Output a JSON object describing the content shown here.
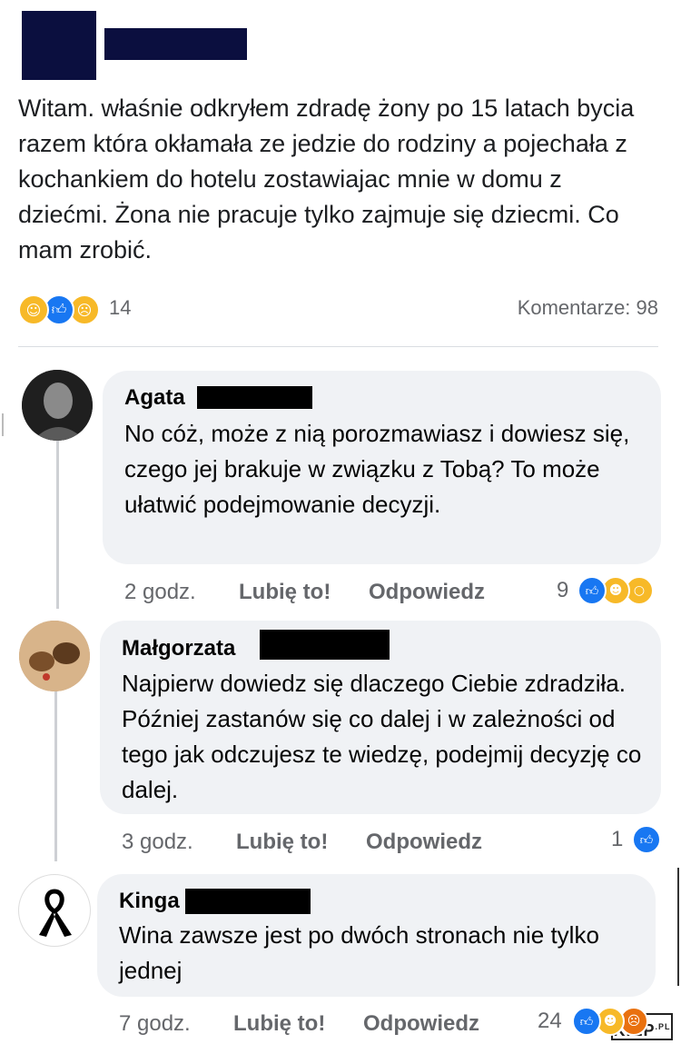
{
  "post": {
    "text": "Witam. właśnie odkryłem zdradę żony po 15 latach bycia razem która okłamała  ze jedzie do rodziny a pojechała z kochankiem do hotelu zostawiajac mnie w domu z dziećmi. Żona nie pracuje tylko zajmuje się dziecmi. Co mam zrobić.",
    "reaction_count": "14",
    "comments_label": "Komentarze: 98",
    "reaction_icons": [
      "care-icon",
      "like-icon",
      "sad-icon"
    ]
  },
  "comments": [
    {
      "name": "Agata",
      "text": "No cóż, może z nią porozmawiasz i dowiesz się, czego jej brakuje w związku z Tobą? To może ułatwić podejmowanie decyzji.",
      "time": "2 godz.",
      "like_label": "Lubię to!",
      "reply_label": "Odpowiedz",
      "reaction_count": "9",
      "reaction_icons": [
        "like-icon",
        "haha-icon",
        "wow-icon"
      ]
    },
    {
      "name": "Małgorzata",
      "text": "Najpierw dowiedz się dlaczego Ciebie zdradziła. Później zastanów się co dalej i w zależności od tego jak odczujesz te wiedzę, podejmij decyzję co dalej.",
      "time": "3 godz.",
      "like_label": "Lubię to!",
      "reply_label": "Odpowiedz",
      "reaction_count": "1",
      "reaction_icons": [
        "like-icon"
      ]
    },
    {
      "name": "Kinga",
      "text": "Wina zawsze jest po dwóch stronach nie tylko jednej",
      "time": "7 godz.",
      "like_label": "Lubię to!",
      "reply_label": "Odpowiedz",
      "reaction_count": "24",
      "reaction_icons": [
        "like-icon",
        "haha-icon",
        "angry-icon"
      ]
    }
  ],
  "watermark": {
    "text": "KIEP",
    "suffix": ".PL"
  },
  "colors": {
    "like": "#1877f2",
    "emoji": "#f7b928",
    "angry": "#e9710f",
    "redaction": "#0b0f3f",
    "bubble": "#f0f2f5"
  }
}
